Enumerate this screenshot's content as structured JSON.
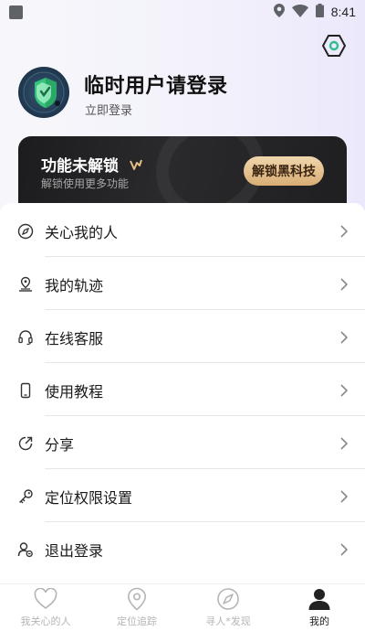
{
  "status_bar": {
    "time": "8:41",
    "icons": [
      "location-icon",
      "wifi-icon",
      "battery-icon"
    ]
  },
  "header": {
    "settings_icon": "settings-hex-icon",
    "user_name": "临时用户请登录",
    "login_link": "立即登录",
    "avatar_icon": "shield-avatar"
  },
  "vip_card": {
    "title": "功能未解锁",
    "subtitle": "解锁使用更多功能",
    "button_label": "解锁黑科技",
    "badge_icon": "vip-badge-icon"
  },
  "menu": {
    "items": [
      {
        "label": "关心我的人",
        "icon": "compass-icon"
      },
      {
        "label": "我的轨迹",
        "icon": "track-icon"
      },
      {
        "label": "在线客服",
        "icon": "headset-icon"
      },
      {
        "label": "使用教程",
        "icon": "phone-icon"
      },
      {
        "label": "分享",
        "icon": "share-icon"
      },
      {
        "label": "定位权限设置",
        "icon": "key-icon"
      },
      {
        "label": "退出登录",
        "icon": "logout-user-icon"
      }
    ]
  },
  "tabs": [
    {
      "label": "我关心的人",
      "icon": "heart-icon",
      "active": false
    },
    {
      "label": "定位追踪",
      "icon": "location-pin-icon",
      "active": false
    },
    {
      "label": "寻人*发现",
      "icon": "compass-icon",
      "active": false
    },
    {
      "label": "我的",
      "icon": "user-icon",
      "active": true
    }
  ],
  "colors": {
    "accent_gold": "#d8ad74",
    "card_dark": "#1c1c1e",
    "active_tab": "#222222",
    "inactive_tab": "#b5b5b5"
  }
}
